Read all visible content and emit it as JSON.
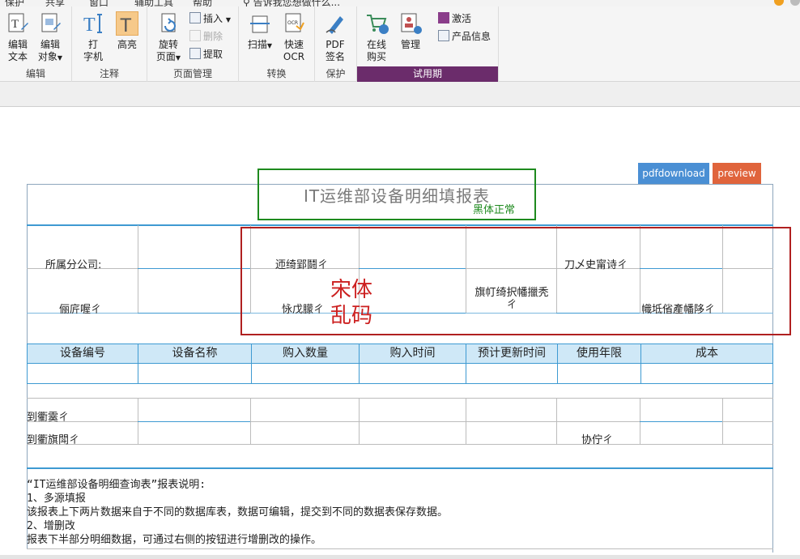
{
  "menubar": {
    "items": [
      "保护",
      "共享",
      "窗口",
      "辅助工具",
      "帮助"
    ],
    "tell_me": "告诉我您想做什么..."
  },
  "ribbon": {
    "groups": {
      "edit": {
        "label": "编辑",
        "edit_text": [
          "编辑",
          "文本"
        ],
        "edit_object": [
          "编辑",
          "对象"
        ]
      },
      "comment": {
        "label": "注释",
        "typewriter": [
          "打",
          "字机"
        ],
        "highlight": "高亮"
      },
      "page_manage": {
        "label": "页面管理",
        "rotate": [
          "旋转",
          "页面"
        ],
        "insert": "插入",
        "delete": "删除",
        "extract": "提取"
      },
      "convert": {
        "label": "转换",
        "scan": "扫描",
        "quick_ocr": [
          "快速",
          "OCR"
        ]
      },
      "protect": {
        "label": "保护",
        "pdf_sign": [
          "PDF",
          "签名"
        ]
      },
      "trial": {
        "label": "试用期",
        "buy_online": [
          "在线",
          "购买"
        ],
        "manage": "管理",
        "activate": "激活",
        "product_info": "产品信息"
      }
    }
  },
  "document": {
    "buttons": {
      "pdfdownload": "pdfdownload",
      "preview": "preview"
    },
    "title": "IT运维部设备明细填报表",
    "annotation_heiti": "黑体正常",
    "annotation_songti": [
      "宋体",
      "乱码"
    ],
    "form_labels": {
      "company": "所属分公司:",
      "garbled_1": "迊绮郢鬪ㄔ",
      "garbled_2": "刀乄史甯诗ㄔ",
      "garbled_3": "俪庍喔ㄔ",
      "garbled_4": "怺戊朦ㄔ",
      "garbled_5": "旗帄绮択幡擸秃ㄔ",
      "garbled_6": "幟坻偗產幡陊ㄔ"
    },
    "table_headers": [
      "设备编号",
      "设备名称",
      "购入数量",
      "购入时间",
      "预计更新时间",
      "使用年限",
      "成本"
    ],
    "lower_labels": {
      "garbled_7": "到衢霙ㄔ",
      "garbled_8": "到衢旗閗ㄔ",
      "garbled_9": "协佇ㄔ"
    },
    "notes": [
      "“IT运维部设备明细查询表”报表说明:",
      "1、多源填报",
      "该报表上下两片数据来自于不同的数据库表，数据可编辑，提交到不同的数据表保存数据。",
      "2、增删改",
      "报表下半部分明细数据，可通过右侧的按钮进行增删改的操作。"
    ]
  },
  "colors": {
    "trial_bar": "#6b2c6b",
    "pdfdownload_btn": "#4a8fd4",
    "preview_btn": "#e0643c",
    "table_header_bg": "#cfe8f7",
    "table_border": "#3e9ad2",
    "green_annotation": "#1e8a1e",
    "red_annotation": "#cc2020"
  }
}
